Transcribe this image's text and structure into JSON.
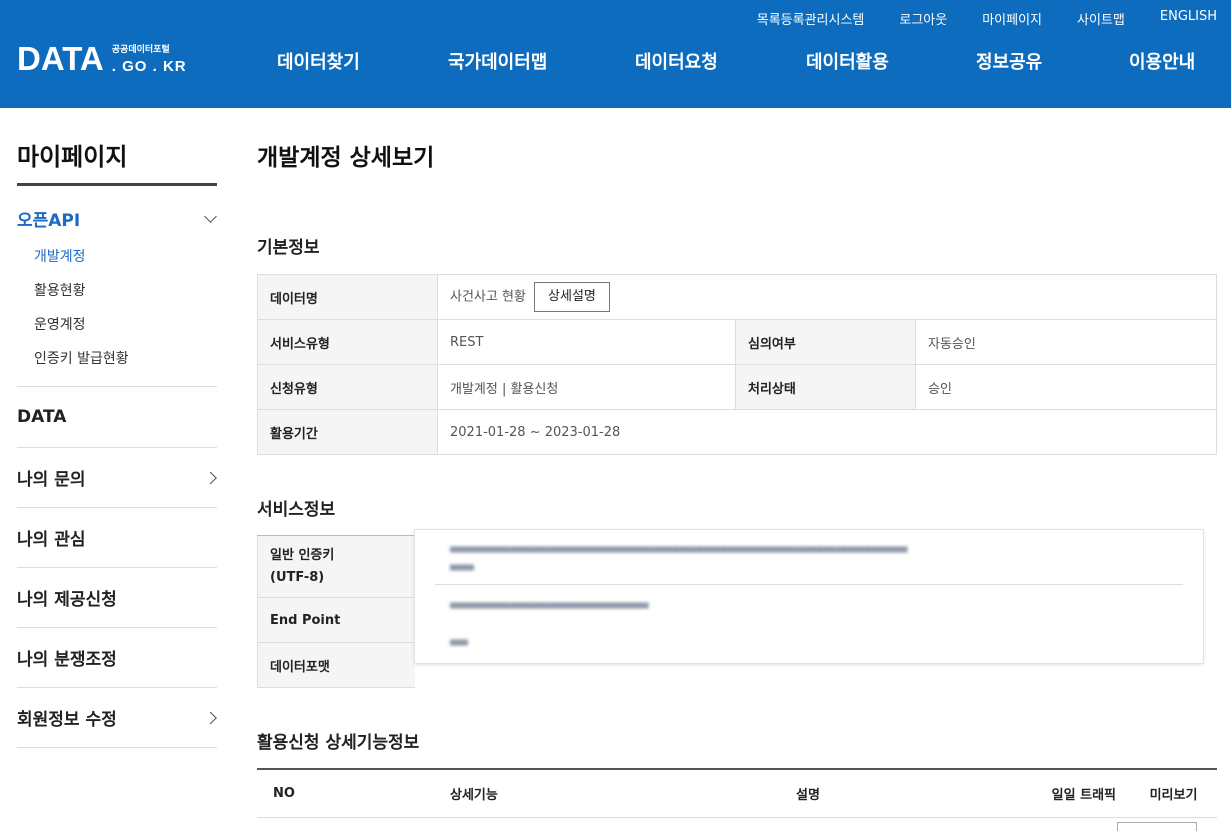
{
  "util_nav": [
    "목록등록관리시스템",
    "로그아웃",
    "마이페이지",
    "사이트맵",
    "ENGLISH"
  ],
  "logo": {
    "main": "DATA",
    "sub_kr": "공공데이터포털",
    "domain": ". GO . KR"
  },
  "gnb": [
    "데이터찾기",
    "국가데이터맵",
    "데이터요청",
    "데이터활용",
    "정보공유",
    "이용안내"
  ],
  "sidebar": {
    "title": "마이페이지",
    "api_head": "오픈API",
    "api_subs": [
      "개발계정",
      "활용현황",
      "운영계정",
      "인증키 발급현황"
    ],
    "items": [
      "DATA",
      "나의 문의",
      "나의 관심",
      "나의 제공신청",
      "나의 분쟁조정",
      "회원정보 수정"
    ]
  },
  "page_title": "개발계정 상세보기",
  "basic": {
    "section": "기본정보",
    "data_name_label": "데이터명",
    "data_name_value": "사건사고 현황",
    "detail_button": "상세설명",
    "service_type_label": "서비스유형",
    "service_type_value": "REST",
    "review_label": "심의여부",
    "review_value": "자동승인",
    "apply_type_label": "신청유형",
    "apply_type_value": "개발계정 | 활용신청",
    "status_label": "처리상태",
    "status_value": "승인",
    "period_label": "활용기간",
    "period_value": "2021-01-28 ~ 2023-01-28"
  },
  "service": {
    "section": "서비스정보",
    "key_label_1": "일반 인증키",
    "key_label_2": "(UTF-8)",
    "endpoint_label": "End Point",
    "format_label": "데이터포맷"
  },
  "func": {
    "section": "활용신청 상세기능정보",
    "columns": [
      "NO",
      "상세기능",
      "설명",
      "일일 트래픽",
      "미리보기"
    ]
  }
}
